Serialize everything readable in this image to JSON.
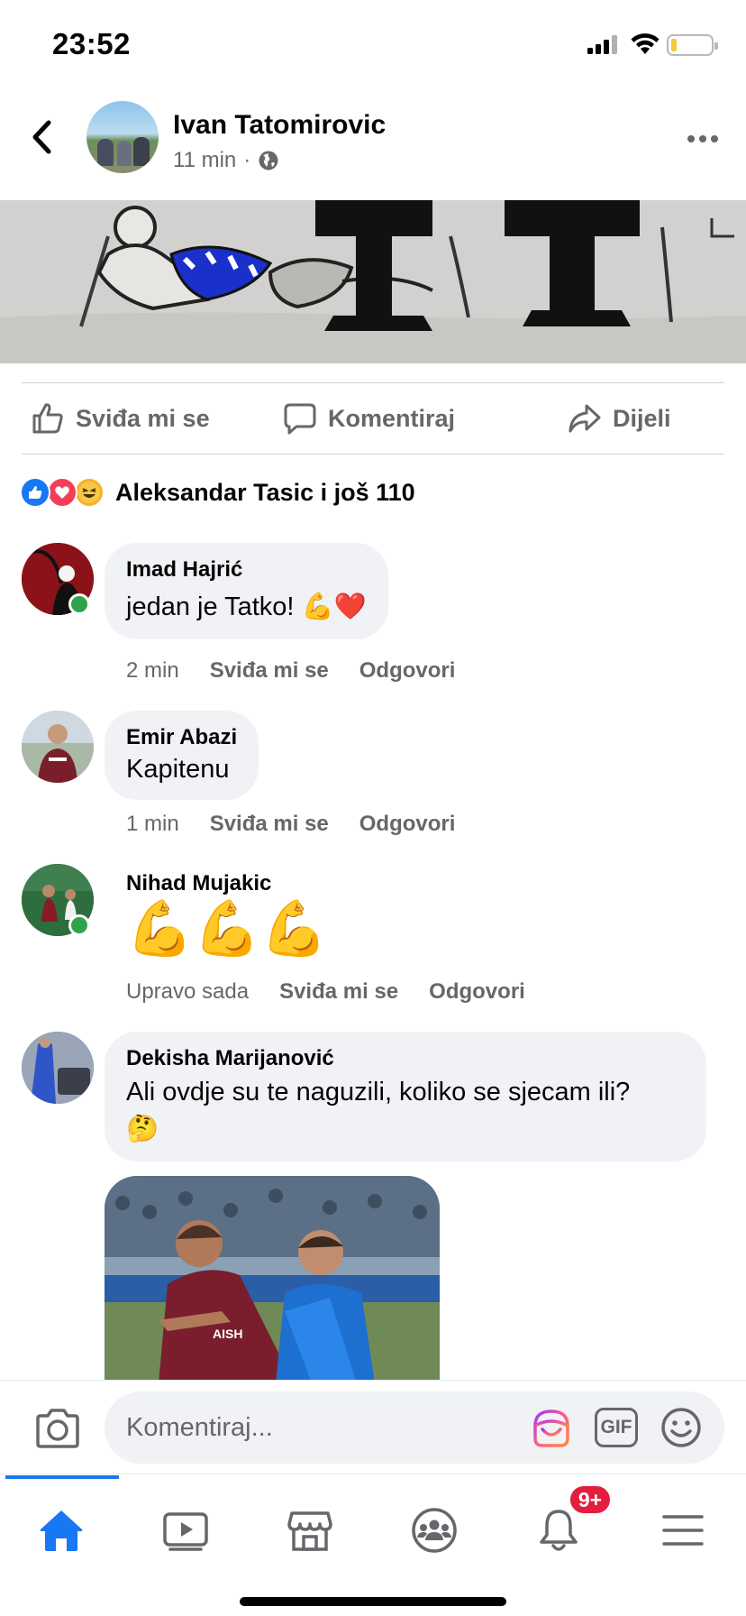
{
  "status_bar": {
    "time": "23:52"
  },
  "post": {
    "author": "Ivan Tatomirovic",
    "time": "11 min",
    "separator": "·"
  },
  "actions": {
    "like": "Sviđa mi se",
    "comment": "Komentiraj",
    "share": "Dijeli"
  },
  "reactions": {
    "summary": "Aleksandar Tasic i još 110"
  },
  "comments": [
    {
      "name": "Imad Hajrić",
      "text": "jedan je Tatko! 💪❤️",
      "time": "2 min",
      "like": "Sviđa mi se",
      "reply": "Odgovori",
      "online": true
    },
    {
      "name": "Emir Abazi",
      "text": "Kapitenu",
      "time": "1 min",
      "like": "Sviđa mi se",
      "reply": "Odgovori",
      "online": false
    },
    {
      "name": "Nihad Mujakic",
      "text": "💪💪💪",
      "time": "Upravo sada",
      "like": "Sviđa mi se",
      "reply": "Odgovori",
      "online": true
    },
    {
      "name": "Dekisha Marijanović",
      "text": "Ali ovdje su te naguzili, koliko se sjecam ili?",
      "text_emoji": "🤔",
      "online": false
    }
  ],
  "composer": {
    "placeholder": "Komentiraj...",
    "gif_label": "GIF"
  },
  "tabs": [
    {
      "name": "home",
      "active": true
    },
    {
      "name": "watch"
    },
    {
      "name": "marketplace"
    },
    {
      "name": "groups"
    },
    {
      "name": "notifications",
      "badge": "9+"
    },
    {
      "name": "menu"
    }
  ],
  "colors": {
    "accent": "#1877f2",
    "muted": "#65676b",
    "bubble": "#f0f2f5",
    "badge": "#e41e3f",
    "online": "#31a24c"
  }
}
